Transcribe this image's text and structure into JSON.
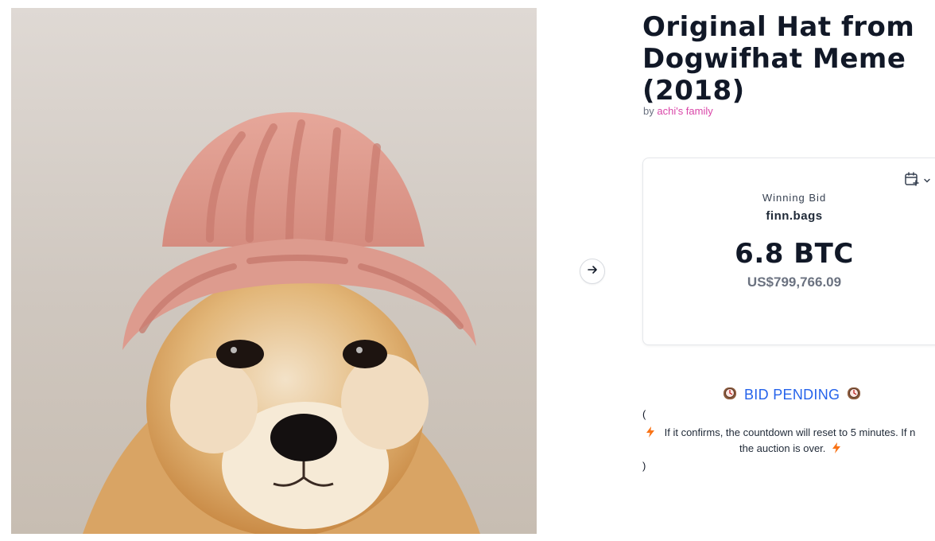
{
  "listing": {
    "title": "Original Hat from Dogwifhat Meme (2018)",
    "by_prefix": "by",
    "artist": "achi's family"
  },
  "image": {
    "alt": "Shiba Inu dog wearing a pink knitted hat",
    "icon": "dog-with-hat"
  },
  "nav": {
    "next_icon": "arrow-right-icon"
  },
  "bid_card": {
    "calendar_icon": "calendar-plus-icon",
    "label": "Winning Bid",
    "bidder": "finn.bags",
    "amount": "6.8 BTC",
    "usd": "US$799,766.09"
  },
  "status": {
    "text": "BID PENDING",
    "open_paren": "(",
    "close_paren": ")",
    "note_line1": "If it confirms, the countdown will reset to 5 minutes. If n",
    "note_line2": "the auction is over."
  },
  "colors": {
    "accent_link": "#d946a8",
    "pending_blue": "#2563eb",
    "bolt": "#f97316"
  }
}
